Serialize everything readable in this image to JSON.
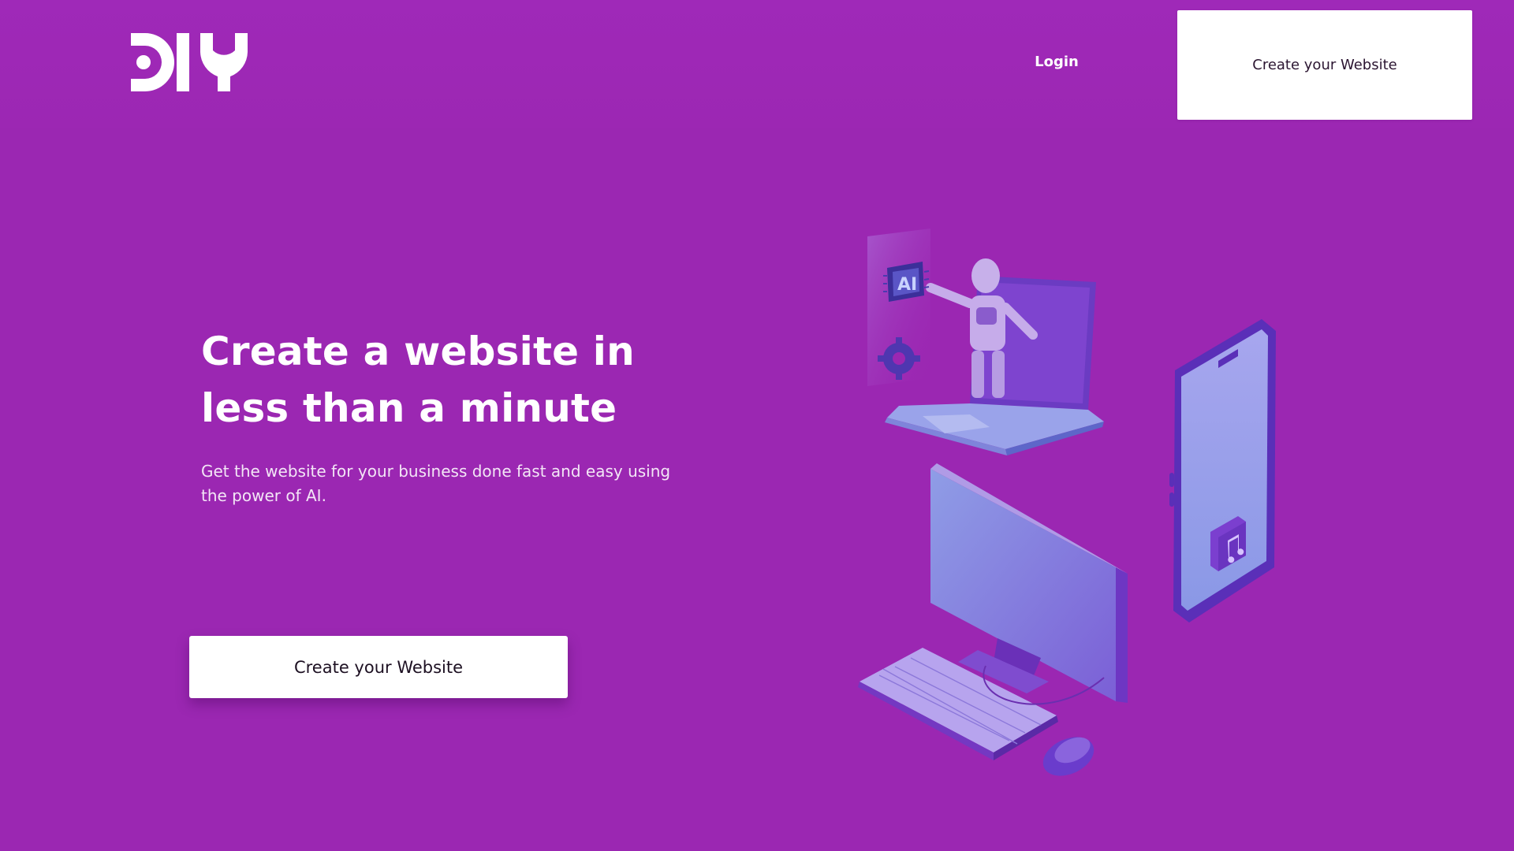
{
  "header": {
    "logo_text": "DIY",
    "login_label": "Login",
    "cta_label": "Create your Website"
  },
  "hero": {
    "title": "Create a website in less than a minute",
    "subtitle": "Get the website for your business done fast and easy using the power of AI.",
    "cta_label": "Create your Website"
  },
  "illustration": {
    "chip_label": "AI",
    "icons": [
      "robot-icon",
      "laptop-icon",
      "chip-icon",
      "gear-icon",
      "monitor-icon",
      "keyboard-icon",
      "mouse-icon",
      "phone-icon",
      "music-note-icon"
    ]
  },
  "colors": {
    "background": "#9b27b2",
    "button_bg": "#ffffff",
    "button_text": "#2b1531",
    "device_light": "#9aa3ea",
    "device_dark": "#6a3fc7"
  }
}
